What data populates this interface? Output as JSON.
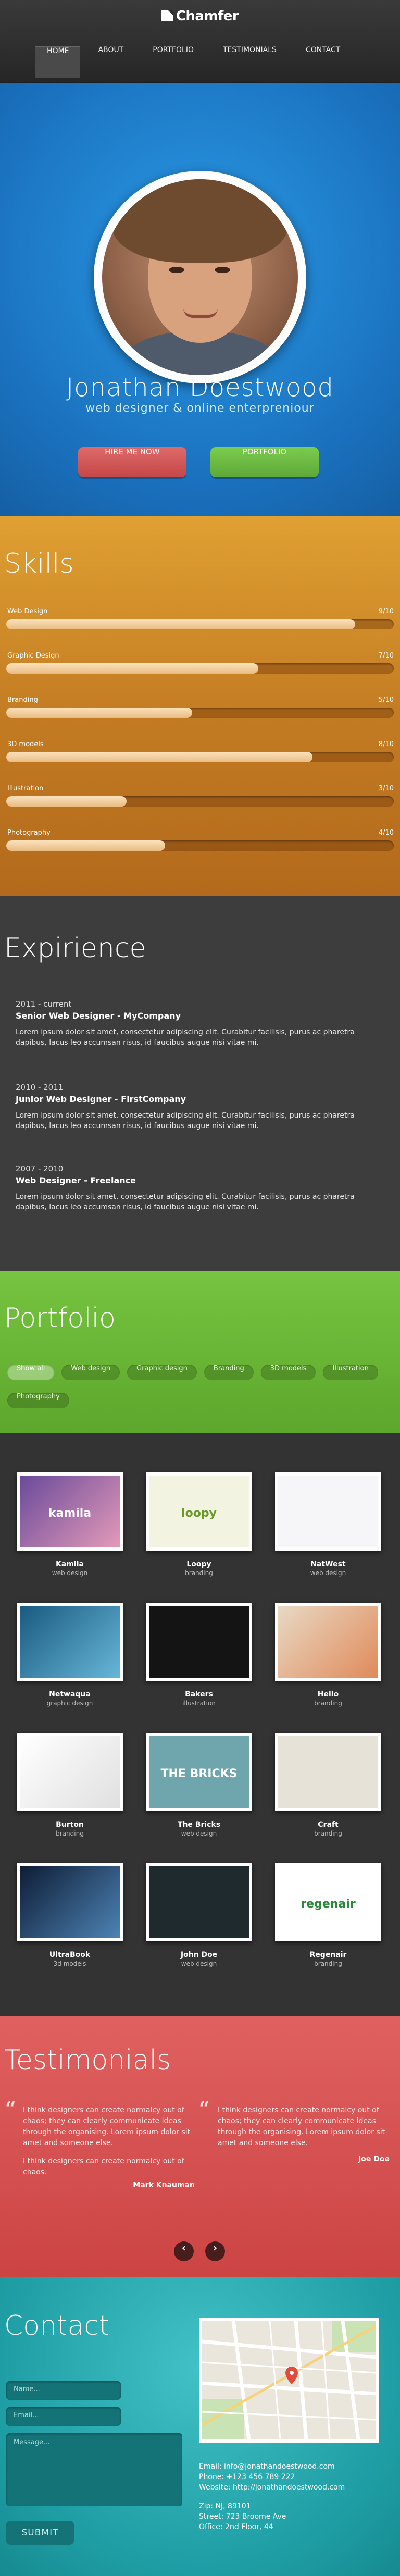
{
  "brand": {
    "name": "Chamfer"
  },
  "nav": [
    "HOME",
    "ABOUT",
    "PORTFOLIO",
    "TESTIMONIALS",
    "CONTACT"
  ],
  "hero": {
    "name": "Jonathan Doestwood",
    "tagline": "web designer & online enterpreniour",
    "hire": "HIRE ME NOW",
    "portfolio": "PORTFOLIO"
  },
  "skills": {
    "title": "Skills",
    "items": [
      {
        "label": "Web Design",
        "score": "9/10",
        "level": 0.9
      },
      {
        "label": "Graphic Design",
        "score": "7/10",
        "level": 0.65
      },
      {
        "label": "Branding",
        "score": "5/10",
        "level": 0.48
      },
      {
        "label": "3D models",
        "score": "8/10",
        "level": 0.79
      },
      {
        "label": "Illustration",
        "score": "3/10",
        "level": 0.31
      },
      {
        "label": "Photography",
        "score": "4/10",
        "level": 0.41
      }
    ]
  },
  "experience": {
    "title": "Expirience",
    "items": [
      {
        "date": "2011 - current",
        "role": "Senior Web Designer - MyCompany",
        "desc": "Lorem ipsum dolor sit amet, consectetur adipiscing elit. Curabitur facilisis, purus ac pharetra dapibus, lacus leo accumsan risus, id faucibus augue nisi vitae mi."
      },
      {
        "date": "2010 - 2011",
        "role": "Junior Web Designer - FirstCompany",
        "desc": "Lorem ipsum dolor sit amet, consectetur adipiscing elit. Curabitur facilisis, purus ac pharetra dapibus, lacus leo accumsan risus, id faucibus augue nisi vitae mi."
      },
      {
        "date": "2007 - 2010",
        "role": "Web Designer - Freelance",
        "desc": "Lorem ipsum dolor sit amet, consectetur adipiscing elit. Curabitur facilisis, purus ac pharetra dapibus, lacus leo accumsan risus, id faucibus augue nisi vitae mi."
      }
    ]
  },
  "portfolio": {
    "title": "Portfolio",
    "filters": [
      "Show all",
      "Web design",
      "Graphic design",
      "Branding",
      "3D models",
      "Illustration",
      "Photography"
    ],
    "active": "Show all",
    "items": [
      {
        "name": "Kamila",
        "cat": "web design",
        "thumb_text": "kamila"
      },
      {
        "name": "Loopy",
        "cat": "branding",
        "thumb_text": "loopy"
      },
      {
        "name": "NatWest",
        "cat": "web design",
        "thumb_text": ""
      },
      {
        "name": "Netwaqua",
        "cat": "graphic design",
        "thumb_text": ""
      },
      {
        "name": "Bakers",
        "cat": "illustration",
        "thumb_text": ""
      },
      {
        "name": "Hello",
        "cat": "branding",
        "thumb_text": ""
      },
      {
        "name": "Burton",
        "cat": "branding",
        "thumb_text": ""
      },
      {
        "name": "The Bricks",
        "cat": "web design",
        "thumb_text": "THE BRICKS"
      },
      {
        "name": "Craft",
        "cat": "branding",
        "thumb_text": ""
      },
      {
        "name": "UltraBook",
        "cat": "3d models",
        "thumb_text": ""
      },
      {
        "name": "John Doe",
        "cat": "web design",
        "thumb_text": ""
      },
      {
        "name": "Regenair",
        "cat": "branding",
        "thumb_text": "regenair"
      }
    ]
  },
  "testimonials": {
    "title": "Testimonials",
    "items": [
      {
        "text": "I think designers can create normalcy out of chaos; they can clearly communicate ideas through the organising. Lorem ipsum dolor sit amet and someone else.",
        "text2": "I think designers can create normalcy out of chaos.",
        "author": "Mark Knauman"
      },
      {
        "text": "I think designers can create normalcy out of chaos; they can clearly communicate ideas through the organising. Lorem ipsum dolor sit amet and someone else.",
        "text2": "",
        "author": "Joe Doe"
      }
    ],
    "prev": "‹",
    "next": "›"
  },
  "contact": {
    "title": "Contact",
    "name_placeholder": "Name...",
    "email_placeholder": "Email...",
    "message_placeholder": "Message...",
    "submit": "SUBMIT",
    "email_label": "Email: ",
    "email": "info@jonathandoestwood.com",
    "phone": "Phone: +123 456 789 222",
    "website_label": "Website: ",
    "website": "http://jonathandoestwood.com",
    "zip": "Zip: NJ, 89101",
    "street": "Street: 723 Broome Ave",
    "office": "Office: 2nd Floor, 44"
  },
  "colors": {
    "hero": "#1a70bd",
    "skills": "#c27a22",
    "experience": "#3d3d3d",
    "portfolio": "#5da72c",
    "gallery": "#333333",
    "testimonials": "#cc4444",
    "contact": "#1e9ea4"
  }
}
